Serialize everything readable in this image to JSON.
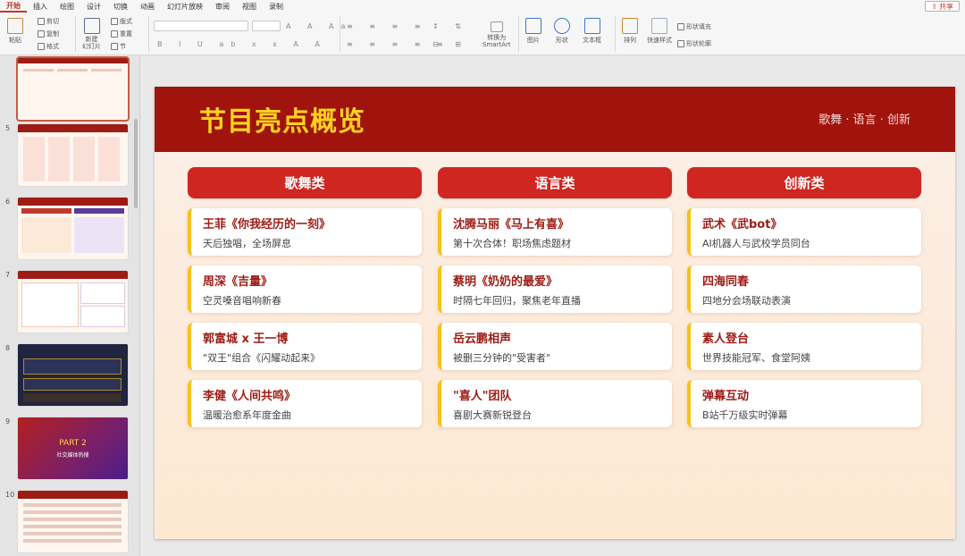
{
  "menu": [
    "开始",
    "插入",
    "绘图",
    "设计",
    "切换",
    "动画",
    "幻灯片放映",
    "审阅",
    "视图",
    "录制"
  ],
  "share_label": "共享",
  "ribbon": {
    "paste": "粘贴",
    "cut": "剪切",
    "copy": "复制",
    "format": "格式",
    "new_slide": "新建\n幻灯片",
    "layout": "版式",
    "reset": "重置",
    "section": "节",
    "convert_smartart": "转换为\nSmartArt",
    "picture": "图片",
    "shape": "形状",
    "textbox": "文本框",
    "arrange": "排列",
    "quick_styles": "快速样式",
    "shape_fill": "形状填充",
    "shape_outline": "形状轮廓"
  },
  "slide_numbers": [
    "5",
    "6",
    "7",
    "8",
    "9",
    "10"
  ],
  "thumb_part": {
    "title": "PART 2",
    "subtitle": "社交媒体热搜"
  },
  "slide": {
    "title": "节目亮点概览",
    "subtitle": "歌舞 · 语言 · 创新",
    "columns": [
      {
        "header": "歌舞类",
        "cards": [
          {
            "title": "王菲《你我经历的一刻》",
            "desc": "天后独唱，全场屏息"
          },
          {
            "title": "周深《吉量》",
            "desc": "空灵嗓音唱响新春"
          },
          {
            "title": "郭富城 x 王一博",
            "desc": "\"双王\"组合《闪耀动起来》"
          },
          {
            "title": "李健《人间共鸣》",
            "desc": "温暖治愈系年度金曲"
          }
        ]
      },
      {
        "header": "语言类",
        "cards": [
          {
            "title": "沈腾马丽《马上有喜》",
            "desc": "第十次合体！职场焦虑题材"
          },
          {
            "title": "蔡明《奶奶的最爱》",
            "desc": "时隔七年回归，聚焦老年直播"
          },
          {
            "title": "岳云鹏相声",
            "desc": "被删三分钟的\"受害者\""
          },
          {
            "title": "\"喜人\"团队",
            "desc": "喜剧大赛新锐登台"
          }
        ]
      },
      {
        "header": "创新类",
        "cards": [
          {
            "title": "武术《武bot》",
            "desc": "AI机器人与武校学员同台"
          },
          {
            "title": "四海同春",
            "desc": "四地分会场联动表演"
          },
          {
            "title": "素人登台",
            "desc": "世界技能冠军、食堂阿姨"
          },
          {
            "title": "弹幕互动",
            "desc": "B站千万级实时弹幕"
          }
        ]
      }
    ]
  }
}
